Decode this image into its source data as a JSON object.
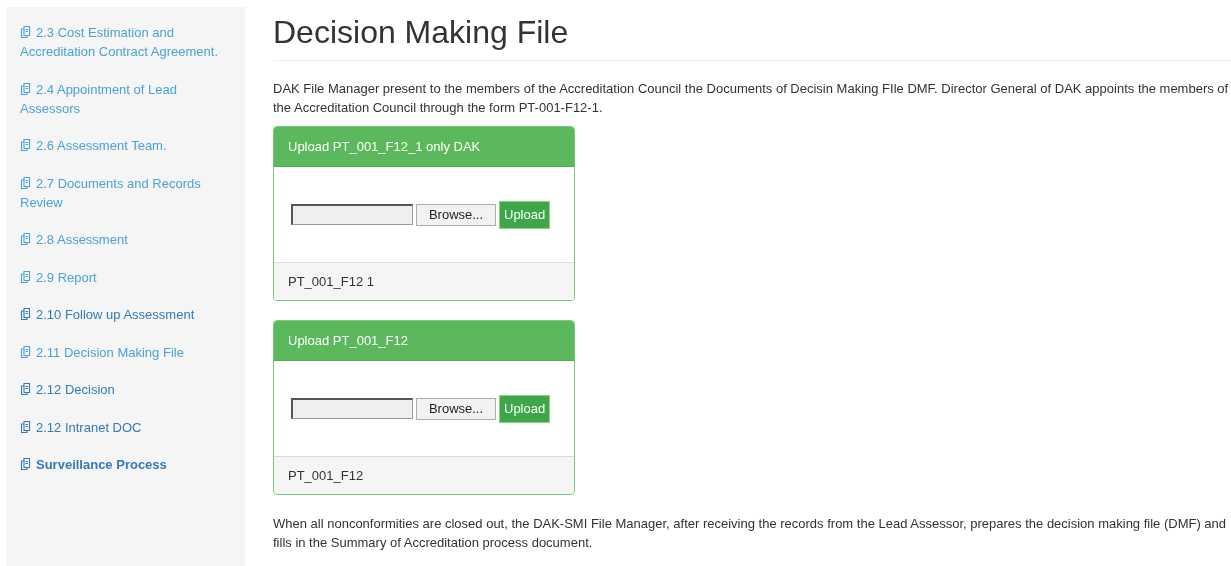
{
  "sidebar": {
    "items": [
      {
        "label": "2.3 Cost Estimation and Accreditation Contract Agreement.",
        "kind": "link",
        "visited": true
      },
      {
        "label": "2.4 Appointment of Lead Assessors",
        "kind": "link",
        "visited": true
      },
      {
        "label": "2.6 Assessment Team.",
        "kind": "link",
        "visited": true
      },
      {
        "label": "2.7 Documents and Records Review",
        "kind": "link",
        "visited": true
      },
      {
        "label": "2.8 Assessment",
        "kind": "link",
        "visited": true
      },
      {
        "label": "2.9 Report",
        "kind": "link",
        "visited": true
      },
      {
        "label": "2.10 Follow up Assessment",
        "kind": "link",
        "visited": false
      },
      {
        "label": "2.11 Decision Making File",
        "kind": "link",
        "visited": true
      },
      {
        "label": "2.12 Decision",
        "kind": "link",
        "visited": false
      },
      {
        "label": "2.12 Intranet DOC",
        "kind": "link",
        "visited": false
      },
      {
        "label": "Surveillance Process",
        "kind": "section",
        "visited": false
      }
    ]
  },
  "page": {
    "title": "Decision Making File",
    "intro": "DAK File Manager present to the members of the Accreditation Council the Documents of Decisin Making FIle DMF. Director General of DAK appoints the members of the Accreditation Council through the form PT-001-F12-1.",
    "panels": [
      {
        "heading": "Upload PT_001_F12_1 only DAK",
        "browse": "Browse...",
        "upload": "Upload",
        "footer": "PT_001_F12 1"
      },
      {
        "heading": "Upload PT_001_F12",
        "browse": "Browse...",
        "upload": "Upload",
        "footer": "PT_001_F12"
      }
    ],
    "outro": "When all nonconformities are closed out, the DAK-SMI File Manager, after receiving the records from the Lead Assessor, prepares the decision making file (DMF) and fills in the Summary of Accreditation process document."
  }
}
